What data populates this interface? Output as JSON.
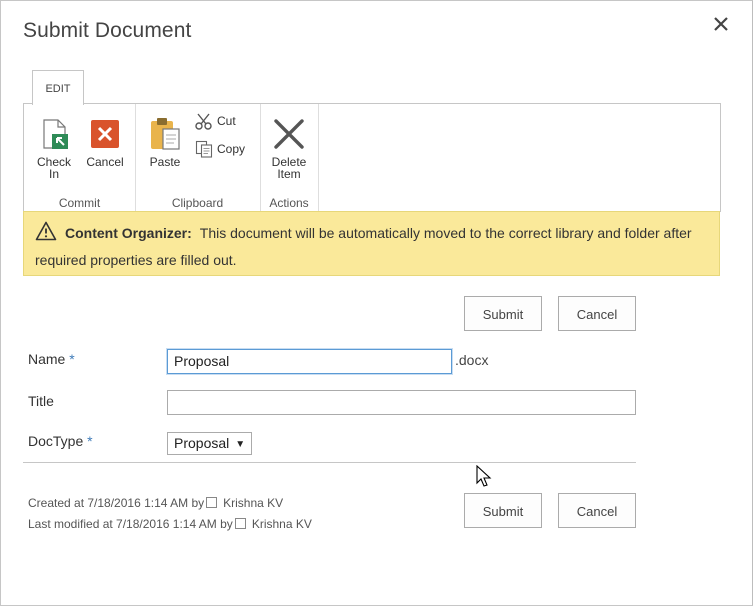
{
  "dialog": {
    "title": "Submit Document",
    "close_label": "×"
  },
  "ribbon": {
    "tab": "EDIT",
    "groups": {
      "commit": {
        "label": "Commit",
        "check_in_line1": "Check",
        "check_in_line2": "In",
        "cancel": "Cancel"
      },
      "clipboard": {
        "label": "Clipboard",
        "paste": "Paste",
        "cut": "Cut",
        "copy": "Copy"
      },
      "actions": {
        "label": "Actions",
        "delete_line1": "Delete",
        "delete_line2": "Item"
      }
    }
  },
  "banner": {
    "title": "Content Organizer:",
    "message": "This document will be automatically moved to the correct library and folder after required properties are filled out."
  },
  "buttons": {
    "submit": "Submit",
    "cancel": "Cancel"
  },
  "form": {
    "name_label": "Name",
    "required_mark": "*",
    "name_value": "Proposal",
    "name_suffix": ".docx",
    "title_label": "Title",
    "title_value": "",
    "doctype_label": "DocType",
    "doctype_value": "Proposal",
    "doctype_arrow": "▼"
  },
  "meta": {
    "created_prefix": "Created at 7/18/2016 1:14 AM  by",
    "created_user": "Krishna KV",
    "modified_prefix": "Last modified at 7/18/2016 1:14 AM  by",
    "modified_user": "Krishna KV"
  },
  "colors": {
    "banner_bg": "#fae99a",
    "cancel_icon": "#d9532c",
    "check_in_icon": "#2e8b57",
    "required_mark": "#3e7bb8"
  }
}
